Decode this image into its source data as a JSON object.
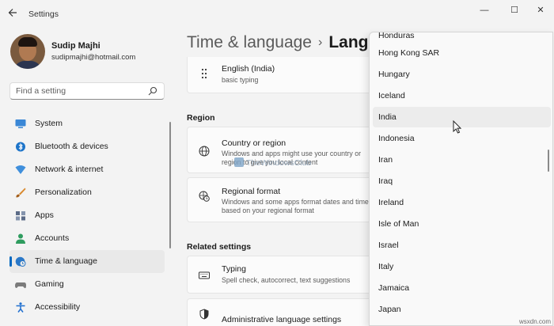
{
  "window": {
    "title": "Settings",
    "controls": [
      "—",
      "☐",
      "✕"
    ]
  },
  "user": {
    "name": "Sudip Majhi",
    "email": "sudipmajhi@hotmail.com"
  },
  "search": {
    "placeholder": "Find a setting"
  },
  "nav": [
    {
      "label": "System",
      "icon": "monitor-icon",
      "color": "#3a87d6"
    },
    {
      "label": "Bluetooth & devices",
      "icon": "bluetooth-icon",
      "color": "#1d74c9"
    },
    {
      "label": "Network & internet",
      "icon": "wifi-icon",
      "color": "#3f8fdc"
    },
    {
      "label": "Personalization",
      "icon": "brush-icon",
      "color": "#d98a2f"
    },
    {
      "label": "Apps",
      "icon": "apps-icon",
      "color": "#5b6b87"
    },
    {
      "label": "Accounts",
      "icon": "person-icon",
      "color": "#2f9c5f"
    },
    {
      "label": "Time & language",
      "icon": "globe-clock-icon",
      "color": "#2a78c8",
      "active": true
    },
    {
      "label": "Gaming",
      "icon": "gamepad-icon",
      "color": "#7b7b7b"
    },
    {
      "label": "Accessibility",
      "icon": "accessibility-icon",
      "color": "#1f6fd0"
    }
  ],
  "header": {
    "crumb": "Time & language",
    "separator": "›",
    "current": "Lang"
  },
  "language_card": {
    "title": "English (India)",
    "subtitle": "basic typing"
  },
  "region": {
    "heading": "Region",
    "country": {
      "title": "Country or region",
      "subtitle": "Windows and apps might use your country or region to give you local content"
    },
    "format": {
      "title": "Regional format",
      "subtitle": "Windows and some apps format dates and time based on your regional format"
    }
  },
  "related": {
    "heading": "Related settings",
    "typing": {
      "title": "Typing",
      "subtitle": "Spell check, autocorrect, text suggestions"
    },
    "admin": {
      "title": "Administrative language settings"
    }
  },
  "watermark": "TheWindowsClub",
  "dropdown": {
    "partial_top": "Honduras",
    "items": [
      "Hong Kong SAR",
      "Hungary",
      "Iceland",
      "India",
      "Indonesia",
      "Iran",
      "Iraq",
      "Ireland",
      "Isle of Man",
      "Israel",
      "Italy",
      "Jamaica",
      "Japan"
    ],
    "hovered": "India"
  },
  "footer": "wsxdn.com"
}
